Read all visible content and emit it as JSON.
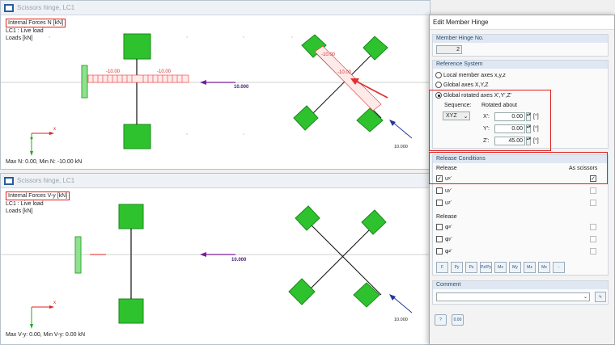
{
  "top": {
    "title": "Scissors hinge, LC1",
    "info_title": "Internal Forces N [kN]",
    "info_lc": "LC1 : Live load",
    "info_loads": "Loads [kN]",
    "label_a": "-10.00",
    "label_b": "-10.00",
    "label_c": "-10.00",
    "label_d": "-10.00",
    "load_value": "10.000",
    "load_value_diag": "10.000",
    "stat": "Max N: 0.00, Min N: -10.00 kN"
  },
  "bottom": {
    "title": "Scissors hinge, LC1",
    "info_title": "Internal Forces V-y [kN]",
    "info_lc": "LC1 : Live load",
    "info_loads": "Loads [kN]",
    "load_value": "10.000",
    "load_value_diag": "10.000",
    "stat": "Max V-y: 0.00, Min V-y: 0.00 kN"
  },
  "dialog": {
    "title": "Edit Member Hinge",
    "hinge_no_header": "Member Hinge No.",
    "hinge_no": "2",
    "ref_header": "Reference System",
    "opt_local": "Local member axes x,y,z",
    "opt_global": "Global axes X,Y,Z",
    "opt_rotated": "Global rotated axes X',Y',Z'",
    "sequence_label": "Sequence:",
    "sequence_value": "XYZ",
    "rotated_about": "Rotated about",
    "x_label": "X':",
    "y_label": "Y':",
    "z_label": "Z':",
    "x_value": "0.00",
    "y_value": "0.00",
    "z_value": "45.00",
    "unit": "[°]",
    "release_header": "Release Conditions",
    "release_label": "Release",
    "as_scissors": "As scissors",
    "u_x": "u",
    "u_y": "u",
    "u_z": "u",
    "release_label2": "Release",
    "phi_x": "φ",
    "phi_y": "φ",
    "phi_z": "φ",
    "comment_header": "Comment",
    "tool_labels": [
      "F",
      "Py",
      "Pz",
      "Pz/Py",
      "Mx",
      "My",
      "Mz",
      "Mx",
      "-"
    ]
  }
}
